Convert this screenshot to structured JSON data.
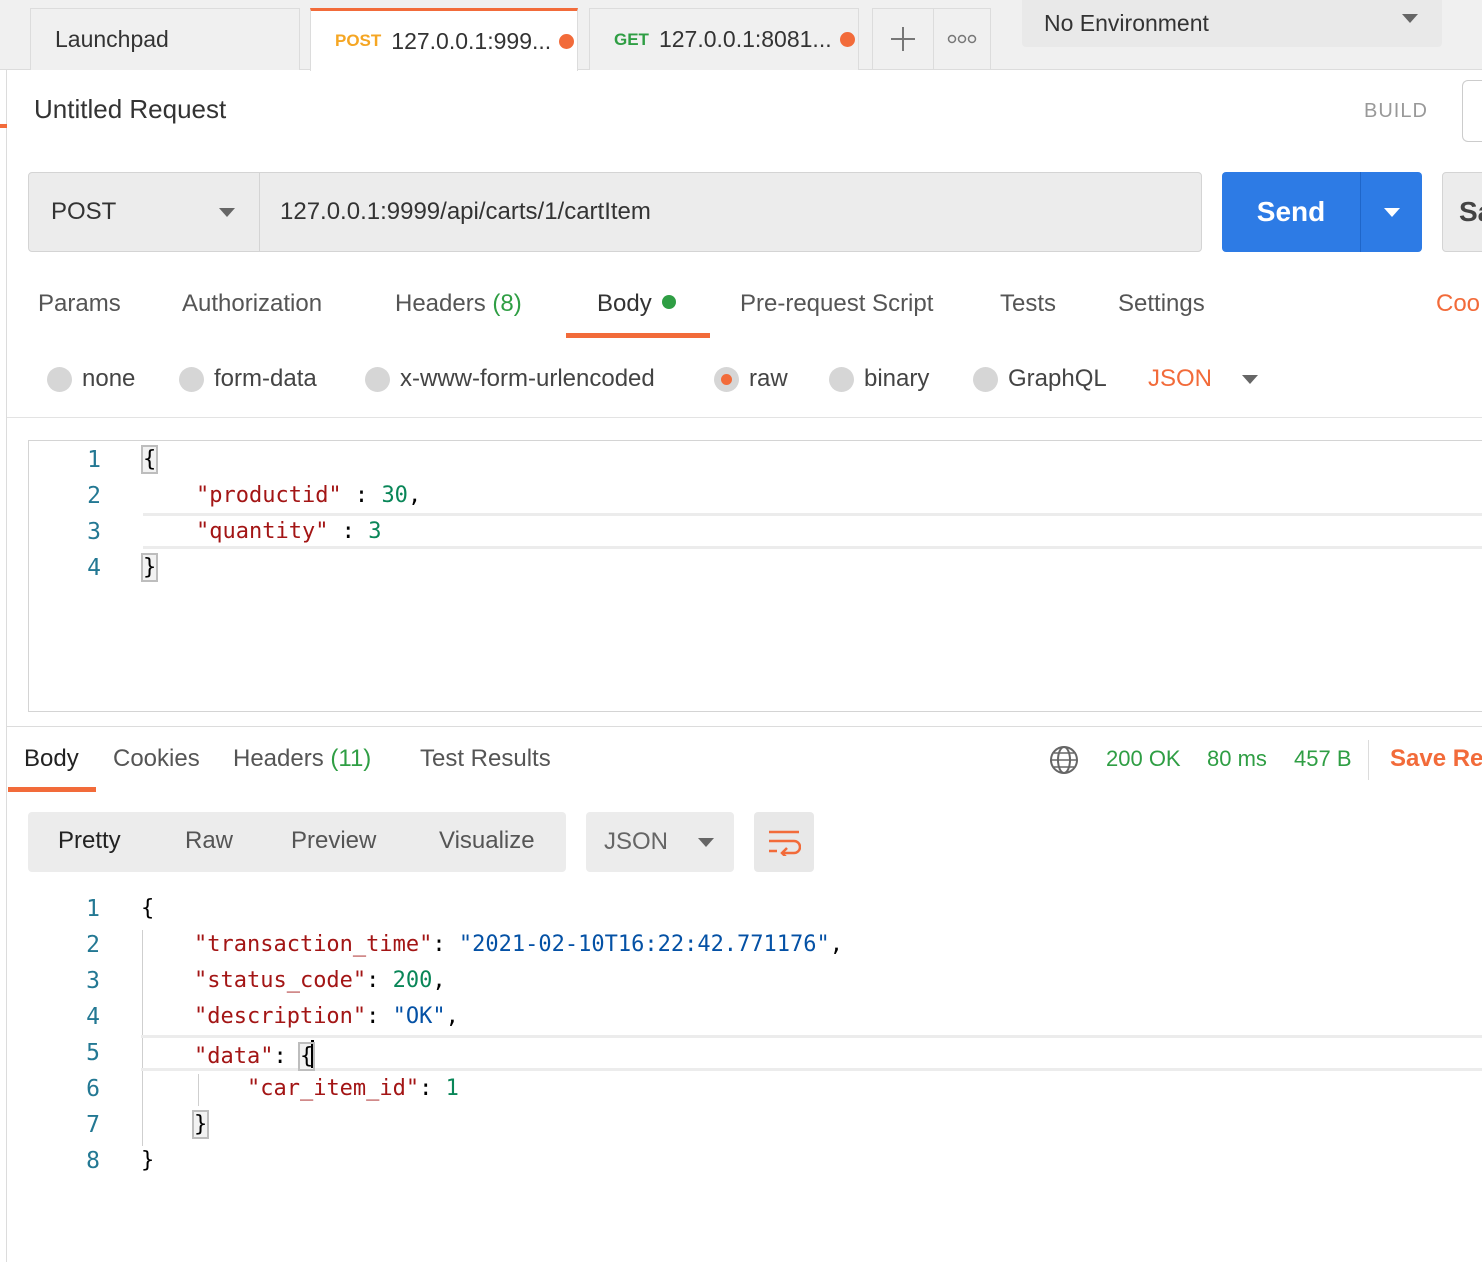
{
  "tabs": [
    {
      "label": "Launchpad",
      "method": "",
      "active": false
    },
    {
      "label": "127.0.0.1:999...",
      "method": "POST",
      "active": true,
      "unsaved": true
    },
    {
      "label": "127.0.0.1:8081...",
      "method": "GET",
      "active": false,
      "unsaved": true
    }
  ],
  "environment": {
    "selected": "No Environment"
  },
  "request": {
    "title": "Untitled Request",
    "build_label": "BUILD",
    "method": "POST",
    "url": "127.0.0.1:9999/api/carts/1/cartItem",
    "send_label": "Send",
    "save_label": "Sa"
  },
  "request_tabs": {
    "params": "Params",
    "authorization": "Authorization",
    "headers": "Headers",
    "headers_count": "(8)",
    "body": "Body",
    "prerequest": "Pre-request Script",
    "tests": "Tests",
    "settings": "Settings",
    "cookies": "Coo"
  },
  "body_types": {
    "none": "none",
    "form_data": "form-data",
    "urlencoded": "x-www-form-urlencoded",
    "raw": "raw",
    "binary": "binary",
    "graphql": "GraphQL",
    "selected": "raw",
    "format": "JSON"
  },
  "request_body": {
    "line_numbers": [
      "1",
      "2",
      "3",
      "4"
    ],
    "l1_open": "{",
    "l2_key": "\"productid\"",
    "l2_sep": " : ",
    "l2_val": "30",
    "l2_comma": ",",
    "l3_key": "\"quantity\"",
    "l3_sep": " : ",
    "l3_val": "3",
    "l4_close": "}"
  },
  "response": {
    "tabs": {
      "body": "Body",
      "cookies": "Cookies",
      "headers": "Headers",
      "headers_count": "(11)",
      "test_results": "Test Results"
    },
    "status": "200 OK",
    "time": "80 ms",
    "size": "457 B",
    "save_label": "Save Re",
    "view_modes": {
      "pretty": "Pretty",
      "raw": "Raw",
      "preview": "Preview",
      "visualize": "Visualize"
    },
    "format": "JSON",
    "line_numbers": [
      "1",
      "2",
      "3",
      "4",
      "5",
      "6",
      "7",
      "8"
    ],
    "body": {
      "open": "{",
      "k_time": "\"transaction_time\"",
      "v_time": "\"2021-02-10T16:22:42.771176\"",
      "k_status": "\"status_code\"",
      "v_status": "200",
      "k_desc": "\"description\"",
      "v_desc": "\"OK\"",
      "k_data": "\"data\"",
      "data_open": "{",
      "k_item": "\"car_item_id\"",
      "v_item": "1",
      "data_close": "}",
      "close": "}",
      "colon": ": ",
      "comma": ","
    }
  },
  "colors": {
    "accent": "#f26b3a",
    "send": "#2d7be5",
    "success": "#2f9e44",
    "post": "#f5a623"
  },
  "icons": [
    "plus-icon",
    "more-icon",
    "caret-down-icon",
    "globe-icon",
    "wrap-lines-icon"
  ]
}
